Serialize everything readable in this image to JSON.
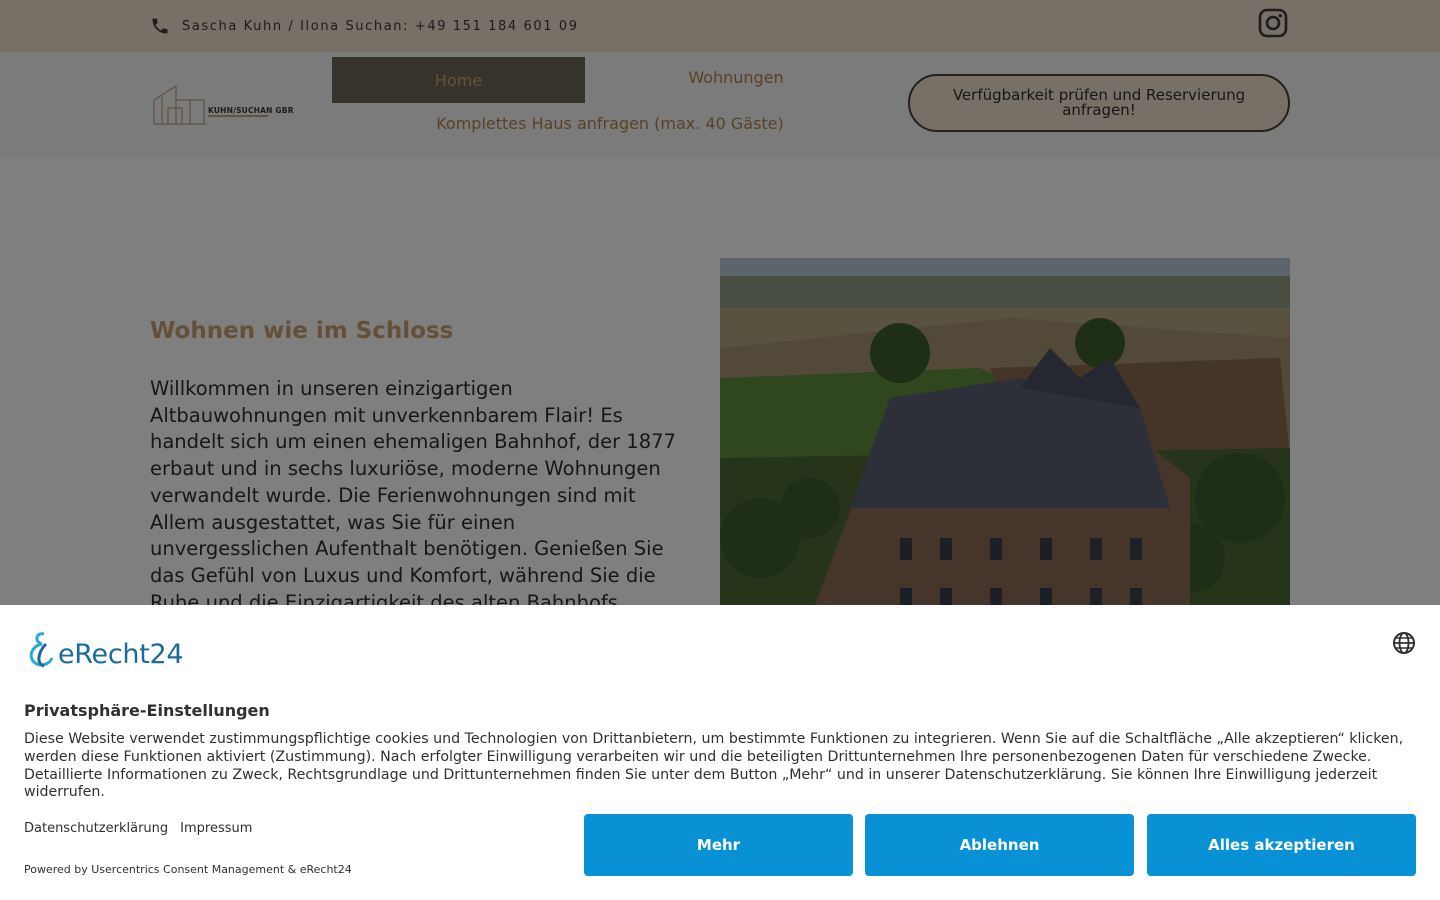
{
  "topbar": {
    "phone_text": "Sascha Kuhn / Ilona Suchan: +49 151 184 601 09"
  },
  "header": {
    "logo_text": "KUHN/SUCHAN GBR",
    "nav": {
      "home": "Home",
      "wohnungen": "Wohnungen",
      "haus": "Komplettes Haus anfragen (max. 40 Gäste)"
    },
    "cta": "Verfügbarkeit prüfen und Reservierung anfragen!"
  },
  "main": {
    "heading": "Wohnen wie im Schloss",
    "intro": "Willkommen in unseren einzigartigen Altbauwohnungen mit unverkennbarem Flair! Es handelt sich um einen ehemaligen Bahnhof, der 1877 erbaut und in sechs luxuriöse, moderne Wohnungen verwandelt wurde. Die Ferienwohnungen sind mit Allem ausgestattet, was Sie für einen unvergesslichen Aufenthalt benötigen. Genießen Sie das Gefühl von Luxus und Komfort, während Sie die Ruhe und die Einzigartigkeit des alten Bahnhofs genießen."
  },
  "consent": {
    "brand": "eRecht24",
    "title": "Privatsphäre-Einstellungen",
    "description": "Diese Website verwendet zustimmungspflichtige cookies und Technologien von Drittanbietern, um bestimmte Funktionen zu integrieren. Wenn Sie auf die Schaltfläche „Alle akzeptieren“ klicken, werden diese Funktionen aktiviert (Zustimmung). Nach erfolgter Einwilligung verarbeiten wir und die beteiligten Drittunternehmen Ihre personenbezogenen Daten für verschiedene Zwecke. Detaillierte Informationen zu Zweck, Rechtsgrundlage und Drittunternehmen finden Sie unter dem Button „Mehr“ und in unserer Datenschutzerklärung. Sie können Ihre Einwilligung jederzeit widerrufen.",
    "link_privacy": "Datenschutzerklärung",
    "link_imprint": "Impressum",
    "powered": "Powered by Usercentrics Consent Management & eRecht24",
    "btn_more": "Mehr",
    "btn_decline": "Ablehnen",
    "btn_accept": "Alles akzeptieren"
  },
  "colors": {
    "topbar_bg": "#ece0cc",
    "accent_gold": "#c9a071",
    "nav_active_bg": "#6c6459",
    "button_blue": "#0892d5",
    "brand_teal": "#1a6a9a"
  },
  "icons": [
    "phone-icon",
    "instagram-icon",
    "logo-house-icon",
    "globe-icon",
    "erecht24-logo-icon"
  ]
}
